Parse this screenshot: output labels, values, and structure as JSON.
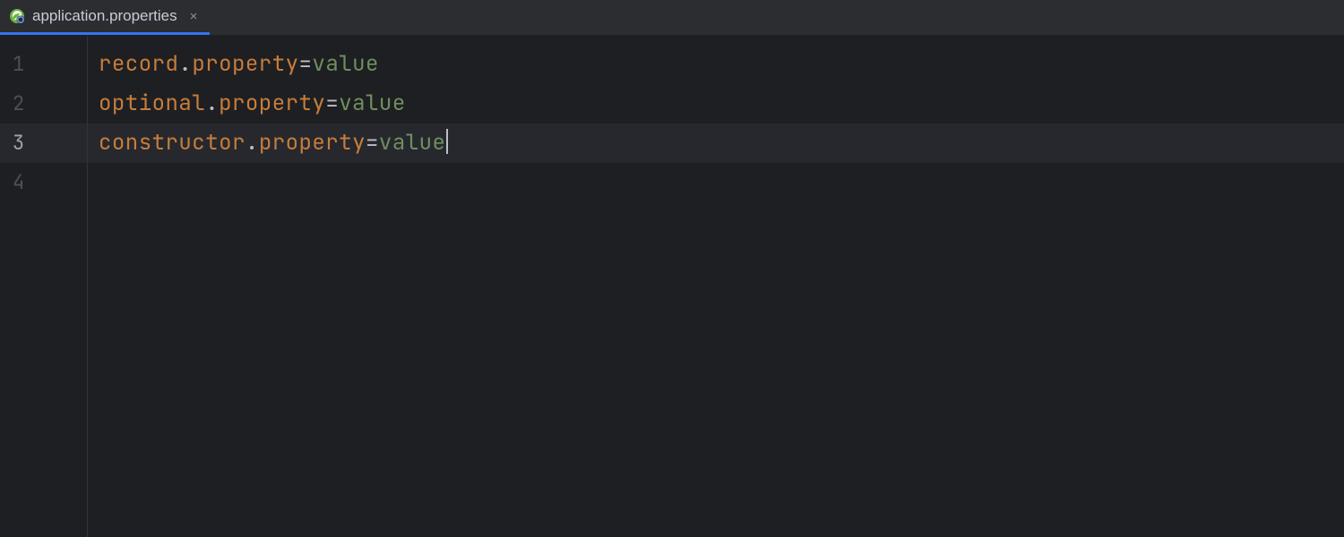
{
  "tab": {
    "label": "application.properties",
    "close_glyph": "×"
  },
  "gutter": [
    "1",
    "2",
    "3",
    "4"
  ],
  "lines": [
    {
      "segments": [
        {
          "cls": "tok-key",
          "t": "record"
        },
        {
          "cls": "tok-dot",
          "t": "."
        },
        {
          "cls": "tok-key",
          "t": "property"
        },
        {
          "cls": "tok-eq",
          "t": "="
        },
        {
          "cls": "tok-val",
          "t": "value"
        }
      ],
      "active": false,
      "caret": false
    },
    {
      "segments": [
        {
          "cls": "tok-key",
          "t": "optional"
        },
        {
          "cls": "tok-dot",
          "t": "."
        },
        {
          "cls": "tok-key",
          "t": "property"
        },
        {
          "cls": "tok-eq",
          "t": "="
        },
        {
          "cls": "tok-val",
          "t": "value"
        }
      ],
      "active": false,
      "caret": false
    },
    {
      "segments": [
        {
          "cls": "tok-key",
          "t": "constructor"
        },
        {
          "cls": "tok-dot",
          "t": "."
        },
        {
          "cls": "tok-key",
          "t": "property"
        },
        {
          "cls": "tok-eq",
          "t": "="
        },
        {
          "cls": "tok-val",
          "t": "value"
        }
      ],
      "active": true,
      "caret": true
    },
    {
      "segments": [],
      "active": false,
      "caret": false
    }
  ],
  "ibeam_glyph": "𝙸"
}
